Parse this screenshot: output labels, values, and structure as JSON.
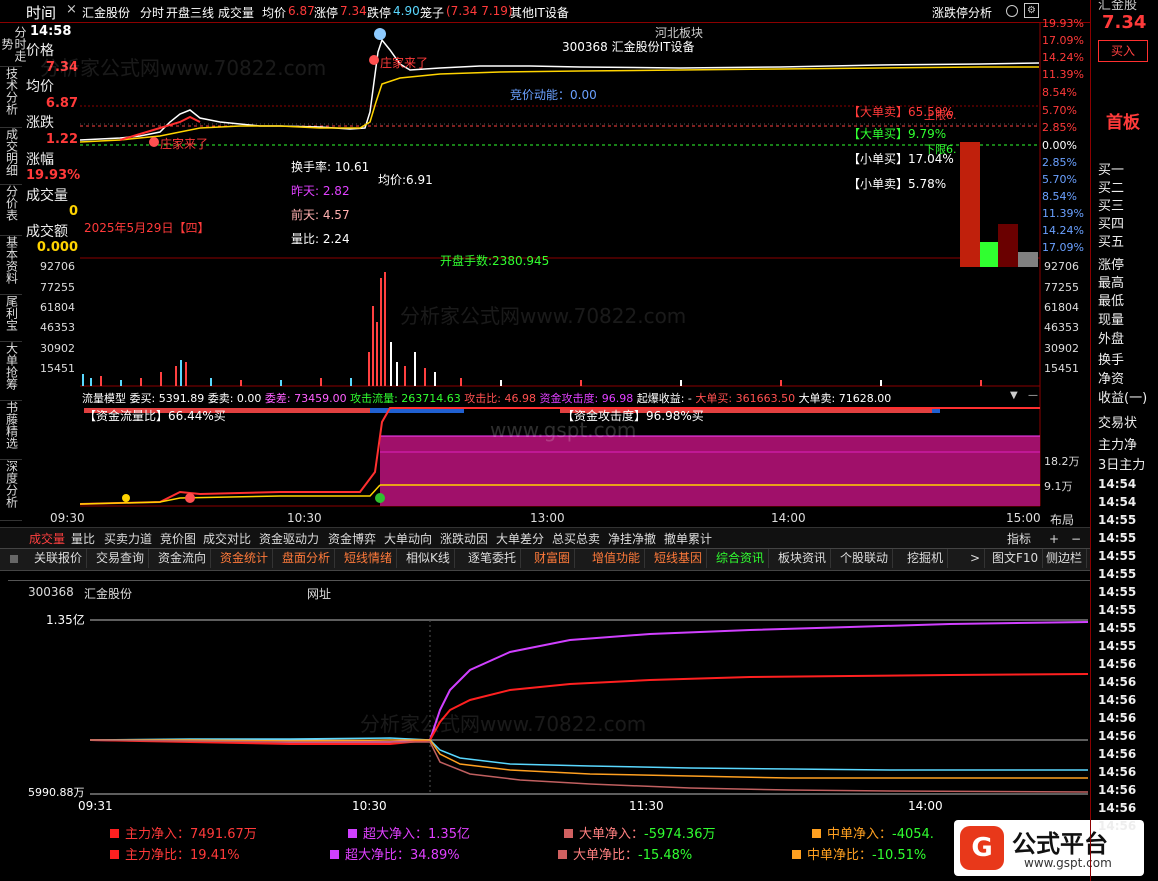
{
  "header": {
    "time_tab": "时间",
    "close": "×",
    "stock_name": "汇金股份",
    "views": [
      "分时",
      "开盘三线",
      "成交量"
    ],
    "avg_label": "均价",
    "avg_val": "6.87",
    "limit_up_label": "涨停",
    "limit_up_val": "7.34",
    "limit_down_label": "跌停",
    "limit_down_val": "4.90",
    "cage_label": "笼子",
    "cage_val": "(7.34 7.19)",
    "sector": "其他IT设备",
    "right_button": "涨跌停分析"
  },
  "left_tabs": [
    "分时走势",
    "技术分析",
    "成交明细",
    "分价表",
    "基本资料",
    "尾利宝",
    "大单抢筹",
    "书藤精选",
    "深度分析"
  ],
  "left_panel": {
    "time": "14:58",
    "price_label": "价格",
    "price": "7.34",
    "avg_label": "均价",
    "avg": "6.87",
    "change_label": "涨跌",
    "change": "1.22",
    "pct_label": "涨幅",
    "pct": "19.93%",
    "vol_label": "成交量",
    "vol": "0",
    "amt_label": "成交额",
    "amt": "0.000"
  },
  "chart_overlay": {
    "sector_tag": "河北板块",
    "code_title": "300368 汇金股份IT设备",
    "banker1": "庄家来了",
    "banker2": "庄家来了",
    "auction": "竞价动能：0.00",
    "turnover": "换手率: 10.61",
    "avg_line": "均价:6.91",
    "yesterday": "昨天: 2.82",
    "day_before": "前天: 4.57",
    "vol_ratio": "量比: 2.24",
    "date": "2025年5月29日【四】",
    "open_hands": "开盘手数:2380.945",
    "big_sell": "【大单卖】65.59%",
    "big_buy": "【大单买】9.79%",
    "small_buy": "【小单买】17.04%",
    "small_sell": "【小单卖】5.78%",
    "upper": "上限6.",
    "lower": "下限6."
  },
  "pct_axis": [
    {
      "v": "19.93%",
      "c": "red"
    },
    {
      "v": "17.09%",
      "c": "red"
    },
    {
      "v": "14.24%",
      "c": "red"
    },
    {
      "v": "11.39%",
      "c": "red"
    },
    {
      "v": "8.54%",
      "c": "red"
    },
    {
      "v": "5.70%",
      "c": "red"
    },
    {
      "v": "2.85%",
      "c": "red"
    },
    {
      "v": "0.00%",
      "c": "white"
    },
    {
      "v": "2.85%",
      "c": "blue"
    },
    {
      "v": "5.70%",
      "c": "blue"
    },
    {
      "v": "8.54%",
      "c": "blue"
    },
    {
      "v": "11.39%",
      "c": "blue"
    },
    {
      "v": "14.24%",
      "c": "blue"
    },
    {
      "v": "17.09%",
      "c": "blue"
    }
  ],
  "vol_axis": [
    "92706",
    "77255",
    "61804",
    "46353",
    "30902",
    "15451"
  ],
  "flow_header": {
    "model": "流量模型",
    "buy": "委买: 5391.89",
    "sell": "委卖: 0.00",
    "diff": "委差: 73459.00",
    "attack": "攻击流量: 263714.63",
    "attack_ratio": "攻击比: 46.98",
    "attack_deg": "资金攻击度: 96.98",
    "burst": "起爆收益: -",
    "big_buy": "大单买: 361663.50",
    "big_sell": "大单卖: 71628.00"
  },
  "flow_labels": {
    "ratio": "【资金流量比】66.44%买",
    "deg": "【资金攻击度】96.98%买",
    "y1": "18.2万",
    "y2": "9.1万"
  },
  "time_axis": [
    "09:30",
    "10:30",
    "13:00",
    "14:00",
    "15:00"
  ],
  "layout_label": "布局",
  "tabs1": [
    "成交量",
    "量比",
    "买卖力道",
    "竞价图",
    "成交对比",
    "资金驱动力",
    "资金博弈",
    "大单动向",
    "涨跌动因",
    "大单差分",
    "总买总卖",
    "净挂净撤",
    "撤单累计"
  ],
  "tabs1_right": [
    "指标",
    "+",
    "−"
  ],
  "toolbar": [
    "关联报价",
    "交易查询",
    "资金流向",
    "资金统计",
    "盘面分析",
    "短线情绪",
    "相似K线",
    "逐笔委托",
    "财富圈",
    "增值功能",
    "短线基因",
    "综合资讯",
    "板块资讯",
    "个股联动",
    "挖掘机",
    ">",
    "图文F10",
    "侧边栏"
  ],
  "toolbar_colors": [
    "#ddd",
    "#ddd",
    "#ddd",
    "#ff7a3a",
    "#ff7a3a",
    "#ff7a3a",
    "#ddd",
    "#ddd",
    "#ff7a3a",
    "#ff7a3a",
    "#ff7a3a",
    "#30ff30",
    "#ddd",
    "#ddd",
    "#ddd",
    "#ddd",
    "#ddd",
    "#ddd"
  ],
  "lower_panel": {
    "code": "300368",
    "name": "汇金股份",
    "site": "网址",
    "y_top": "1.35亿",
    "y_bottom": "5990.88万",
    "time_axis": [
      "09:31",
      "10:30",
      "11:30",
      "14:00"
    ]
  },
  "legend": {
    "r1": [
      {
        "label": "主力净入：",
        "value": "7491.67万",
        "sq": "#ff2020",
        "vc": "red"
      },
      {
        "label": "超大净入：",
        "value": "1.35亿",
        "sq": "#d040ff",
        "vc": "pur"
      },
      {
        "label": "大单净入：",
        "value": "-5974.36万",
        "sq": "#d06060",
        "vc": "grn"
      },
      {
        "label": "中单净入：",
        "value": "-4054.",
        "sq": "#ffa020",
        "vc": "grn"
      }
    ],
    "r2": [
      {
        "label": "主力净比：",
        "value": "19.41%",
        "sq": "#ff2020",
        "vc": "red"
      },
      {
        "label": "超大净比：",
        "value": "34.89%",
        "sq": "#d040ff",
        "vc": "pur"
      },
      {
        "label": "大单净比：",
        "value": "-15.48%",
        "sq": "#d06060",
        "vc": "grn"
      },
      {
        "label": "中单净比：",
        "value": "-10.51%",
        "sq": "#ffa020",
        "vc": "grn"
      }
    ]
  },
  "right_panel": {
    "top_text": "汇金股",
    "price": "7.34",
    "buy_button": "买入",
    "home": "首板",
    "book": [
      "买一",
      "买二",
      "买三",
      "买四",
      "买五",
      "涨停",
      "最高",
      "最低",
      "现量",
      "外盘",
      "换手",
      "净资",
      "收益(一)"
    ],
    "trade_label": "交易状",
    "main_net": "主力净",
    "three_day": "3日主力",
    "times": [
      "14:54",
      "14:54",
      "14:55",
      "14:55",
      "14:55",
      "14:55",
      "14:55",
      "14:55",
      "14:55",
      "14:55",
      "14:56",
      "14:56",
      "14:56",
      "14:56",
      "14:56",
      "14:56",
      "14:56",
      "14:56",
      "14:56",
      "14:56"
    ]
  },
  "logo": {
    "text": "公式平台",
    "site": "www.gspt.com"
  },
  "watermark": {
    "main": "分析家公式网www.70822.com",
    "gspt": "www.gspt.com"
  }
}
